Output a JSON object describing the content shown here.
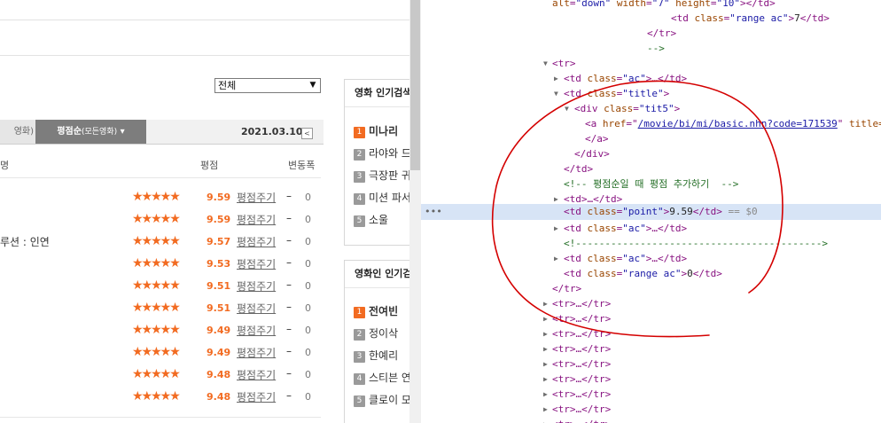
{
  "left": {
    "filter_select": {
      "value": "전체"
    },
    "tabs": {
      "prev_label": "영화)",
      "active_label": "평점순",
      "active_sub": "(모든영화)",
      "active_arrow": "▾",
      "date": "2021.03.10",
      "nav_prev": "<"
    },
    "columns": {
      "title_frag": "명",
      "rating": "평점",
      "change": "변동폭"
    },
    "rows": [
      {
        "title_frag": "",
        "stars": "★★★★★",
        "score": "9.59",
        "rate_link": "평점주기",
        "dash": "–",
        "change": "0"
      },
      {
        "title_frag": "",
        "stars": "★★★★★",
        "score": "9.59",
        "rate_link": "평점주기",
        "dash": "–",
        "change": "0"
      },
      {
        "title_frag": "루션 : 인연",
        "stars": "★★★★★",
        "score": "9.57",
        "rate_link": "평점주기",
        "dash": "–",
        "change": "0"
      },
      {
        "title_frag": "",
        "stars": "★★★★★",
        "score": "9.53",
        "rate_link": "평점주기",
        "dash": "–",
        "change": "0"
      },
      {
        "title_frag": "",
        "stars": "★★★★★",
        "score": "9.51",
        "rate_link": "평점주기",
        "dash": "–",
        "change": "0"
      },
      {
        "title_frag": "",
        "stars": "★★★★★",
        "score": "9.51",
        "rate_link": "평점주기",
        "dash": "–",
        "change": "0"
      },
      {
        "title_frag": "",
        "stars": "★★★★★",
        "score": "9.49",
        "rate_link": "평점주기",
        "dash": "–",
        "change": "0"
      },
      {
        "title_frag": "",
        "stars": "★★★★★",
        "score": "9.49",
        "rate_link": "평점주기",
        "dash": "–",
        "change": "0"
      },
      {
        "title_frag": "",
        "stars": "★★★★★",
        "score": "9.48",
        "rate_link": "평점주기",
        "dash": "–",
        "change": "0"
      },
      {
        "title_frag": "",
        "stars": "★★★★★",
        "score": "9.48",
        "rate_link": "평점주기",
        "dash": "–",
        "change": "0"
      }
    ],
    "movie_search_box": {
      "title": "영화 인기검색",
      "items": [
        {
          "num": "1",
          "name": "미나리"
        },
        {
          "num": "2",
          "name": "라야와 드"
        },
        {
          "num": "3",
          "name": "극장판 귀"
        },
        {
          "num": "4",
          "name": "미션 파서"
        },
        {
          "num": "5",
          "name": "소울"
        }
      ]
    },
    "person_search_box": {
      "title": "영화인 인기검",
      "items": [
        {
          "num": "1",
          "name": "전여빈"
        },
        {
          "num": "2",
          "name": "정이삭"
        },
        {
          "num": "3",
          "name": "한예리"
        },
        {
          "num": "4",
          "name": "스티븐 연"
        },
        {
          "num": "5",
          "name": "클로이 모"
        }
      ]
    }
  },
  "devtools": {
    "l1": {
      "an": "alt",
      "av": "\"down\"",
      "an2": "width",
      "av2": "\"7\"",
      "an3": "height",
      "av3": "\"10\"",
      "end": "></td>"
    },
    "l2": {
      "open": "<td ",
      "an": "class",
      "av": "\"range ac\"",
      "mid": ">",
      "text": "7",
      "close": "</td>"
    },
    "l3": {
      "text": "</tr>"
    },
    "l4": {
      "text": "-->"
    },
    "l5": {
      "text": "<tr>"
    },
    "l6": {
      "open": "<td ",
      "an": "class",
      "av": "\"ac\"",
      "rest": ">…</td>"
    },
    "l7": {
      "open": "<td ",
      "an": "class",
      "av": "\"title\"",
      "rest": ">"
    },
    "l8": {
      "open": "<div ",
      "an": "class",
      "av": "\"tit5\"",
      "rest": ">"
    },
    "l9": {
      "open": "<a ",
      "an": "href",
      "eq": "=\"",
      "link": "/movie/bi/mi/basic.nhn?code=171539",
      "q": "\"",
      "an2": " title="
    },
    "l10": {
      "text": "</a>"
    },
    "l11": {
      "text": "</div>"
    },
    "l12": {
      "text": "</td>"
    },
    "l13": {
      "text": "<!-- 평점순일 때 평점 추가하기  -->"
    },
    "l14": {
      "text": "<td>…</td>"
    },
    "l15": {
      "open": "<td ",
      "an": "class",
      "av": "\"point\"",
      "mid": ">",
      "text": "9.59",
      "close": "</td>",
      "marker": " == $0"
    },
    "l16": {
      "open": "<td ",
      "an": "class",
      "av": "\"ac\"",
      "rest": ">…</td>"
    },
    "l17": {
      "text": "<!------------------------------------------>"
    },
    "l18": {
      "open": "<td ",
      "an": "class",
      "av": "\"ac\"",
      "rest": ">…</td>"
    },
    "l19": {
      "open": "<td ",
      "an": "class",
      "av": "\"range ac\"",
      "mid": ">",
      "text": "0",
      "close": "</td>"
    },
    "l20": {
      "text": "</tr>"
    },
    "collapsed_tr": "<tr>…</tr>",
    "selected_dots": "•••"
  },
  "colors": {
    "accent": "#f26b21",
    "annotation": "#d40000",
    "selection": "#d7e4f6"
  }
}
